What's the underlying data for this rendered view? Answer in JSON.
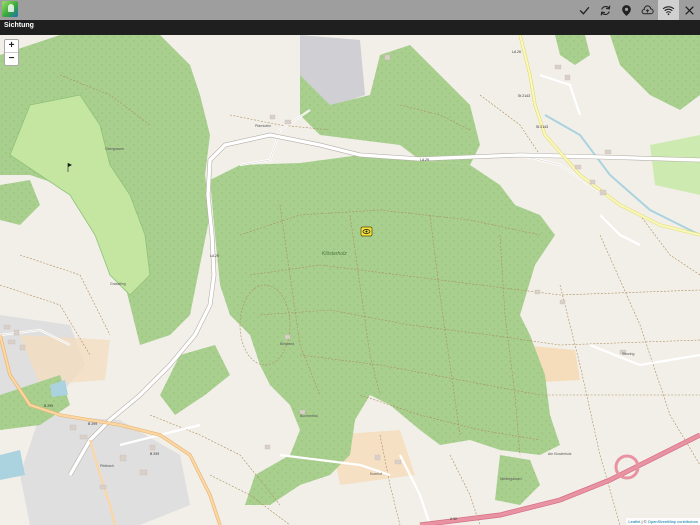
{
  "app": {
    "title": "Sichtung",
    "toolbar": [
      {
        "icon": "check-icon"
      },
      {
        "icon": "sync-icon"
      },
      {
        "icon": "location-pin-icon"
      },
      {
        "icon": "cloud-upload-icon"
      },
      {
        "icon": "wifi-icon",
        "active": true
      },
      {
        "icon": "close-icon"
      }
    ]
  },
  "map": {
    "zoom_in_label": "+",
    "zoom_out_label": "−",
    "attribution": {
      "leaflet": "Leaflet",
      "separator": " | © ",
      "osm": "OpenStreetMap contributors"
    },
    "labels": {
      "road_la29_north": "LA 29",
      "road_la29_west": "LA 29",
      "road_la26": "LA 26",
      "road_st2143": "St 2143",
      "road_st2143_b": "St 2143",
      "road_b299_a": "B 299",
      "road_b299_b": "B 299",
      "road_b299_c": "B 299",
      "road_a92": "A 92",
      "forest_kloesterholz": "Klösterholz",
      "place_pfarrkofen": "Pfarrkofen",
      "place_obergossen": "Obergossen",
      "place_grasslfing": "Grasslfing",
      "place_buchenthal": "Buchenthal",
      "place_bleiwand": "Bleiwand",
      "place_am_klosterholz": "Am Klosterholz",
      "place_niedergassen": "Niedergassen",
      "place_kumhof": "Kumhof",
      "place_stinzing": "Stinzing",
      "place_pfettrach": "Pfettrach"
    },
    "colors": {
      "forest": "#a9cf8f",
      "background": "#f2efe9",
      "motorway": "#e892a2",
      "primary_road": "#fcd6a4",
      "water": "#aad3df"
    }
  }
}
